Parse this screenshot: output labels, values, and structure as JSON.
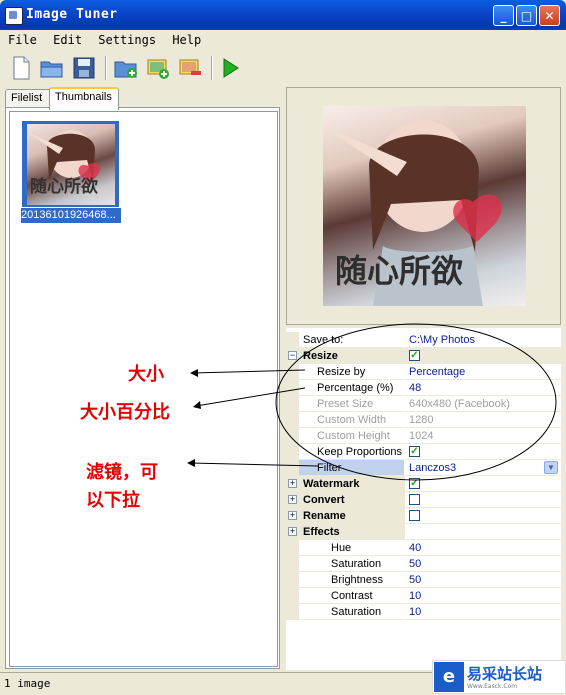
{
  "window": {
    "title": "Image Tuner",
    "min_glyph": "_",
    "max_glyph": "□",
    "close_glyph": "✕"
  },
  "menu": [
    "File",
    "Edit",
    "Settings",
    "Help"
  ],
  "toolbar": {
    "buttons": [
      "new-document",
      "open-folder",
      "save",
      "add-folder",
      "add-images",
      "remove-images",
      "run"
    ]
  },
  "tabs": [
    {
      "label": "Filelist",
      "active": false
    },
    {
      "label": "Thumbnails",
      "active": true
    }
  ],
  "thumbnails": [
    {
      "caption": "20136101926468...",
      "overlay_text": "随心所欲",
      "selected": true
    }
  ],
  "preview": {
    "overlay_text": "随心所欲"
  },
  "properties": {
    "save_to": {
      "name": "Save to:",
      "value": "C:\\My Photos"
    },
    "resize": {
      "name": "Resize",
      "checked": true,
      "expanded": "−"
    },
    "resize_by": {
      "name": "Resize by",
      "value": "Percentage"
    },
    "percentage": {
      "name": "Percentage (%)",
      "value": "48"
    },
    "preset_size": {
      "name": "Preset Size",
      "value": "640x480 (Facebook)"
    },
    "custom_width": {
      "name": "Custom Width",
      "value": "1280"
    },
    "custom_height": {
      "name": "Custom Height",
      "value": "1024"
    },
    "keep_proportions": {
      "name": "Keep Proportions",
      "checked": true
    },
    "filter": {
      "name": "Filter",
      "value": "Lanczos3"
    },
    "watermark": {
      "name": "Watermark",
      "checked": true,
      "expanded": "+"
    },
    "convert": {
      "name": "Convert",
      "checked": false,
      "expanded": "+"
    },
    "rename": {
      "name": "Rename",
      "checked": false,
      "expanded": "+"
    },
    "effects": {
      "name": "Effects",
      "expanded": "+"
    },
    "hue": {
      "name": "Hue",
      "value": "40"
    },
    "saturation1": {
      "name": "Saturation",
      "value": "50"
    },
    "brightness": {
      "name": "Brightness",
      "value": "50"
    },
    "contrast": {
      "name": "Contrast",
      "value": "10"
    },
    "saturation2": {
      "name": "Saturation",
      "value": "10"
    }
  },
  "annotations": {
    "size": "大小",
    "size_percent": "大小百分比",
    "filter_line1": "滤镜，可",
    "filter_line2": "以下拉"
  },
  "status": {
    "text": "1 image"
  },
  "watermark_badge": {
    "logo": "e",
    "text": "易采站长站",
    "sub": "Www.Easck.Com"
  },
  "colors": {
    "accent": "#316ac5",
    "annotation": "#e60000",
    "title_bar": "#0a47c8"
  }
}
